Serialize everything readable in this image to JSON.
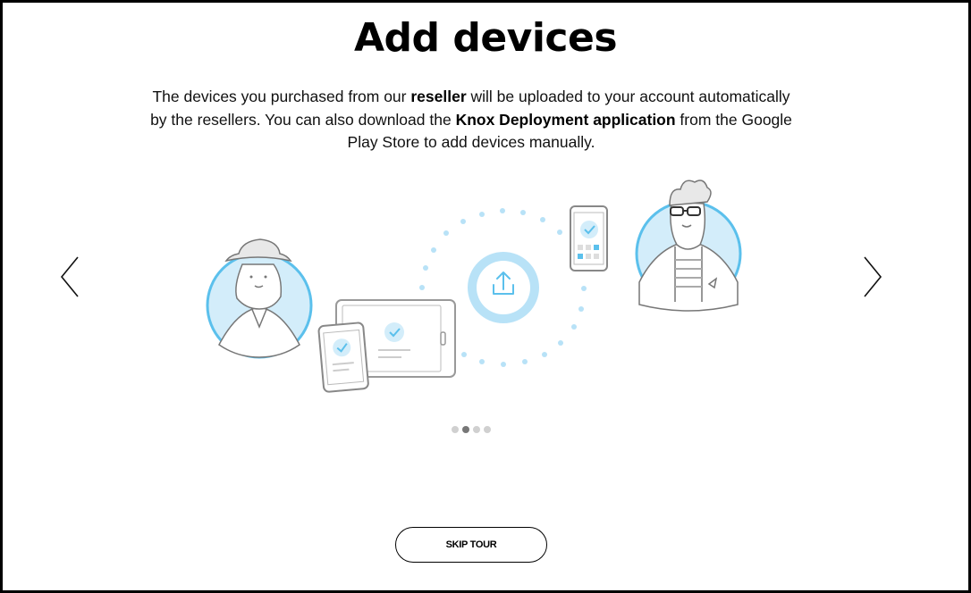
{
  "tour": {
    "title": "Add devices",
    "description": {
      "t1": "The devices you purchased from our ",
      "b1": "reseller",
      "t2": " will be uploaded to your account automatically by the resellers. You can also download the ",
      "b2": "Knox Deployment application",
      "t3": " from the Google Play Store to add devices manually."
    },
    "pagination": {
      "total": 4,
      "current": 2
    },
    "skip_label": "SKIP TOUR"
  },
  "icons": {
    "prev": "chevron-left-icon",
    "next": "chevron-right-icon",
    "upload": "upload-icon",
    "check": "check-circle-icon"
  },
  "colors": {
    "accent_light_blue": "#b8e2f7",
    "accent_blue": "#5bc0ec",
    "line_gray": "#9a9a9a"
  }
}
